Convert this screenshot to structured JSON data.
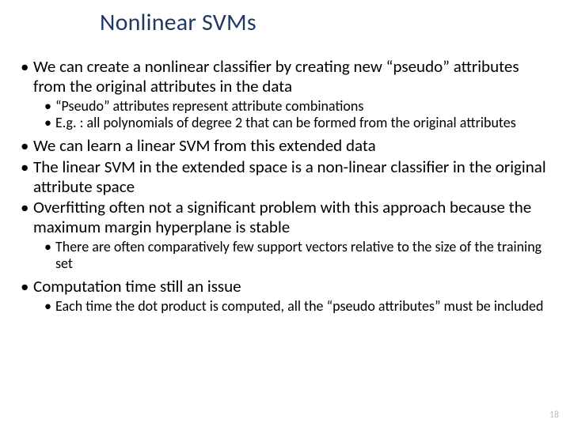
{
  "title": "Nonlinear SVMs",
  "bullets": {
    "b1": "We can create a nonlinear classifier by creating new “pseudo” attributes from the original attributes in the data",
    "b1s": {
      "a": "“Pseudo” attributes represent attribute combinations",
      "b": "E.g. : all polynomials of degree 2 that can be formed from the original attributes"
    },
    "b2": "We can learn a linear SVM from this extended data",
    "b3": "The linear SVM in the extended space is a non-linear classifier in the original attribute space",
    "b4": "Overfitting often not a significant problem with this approach because the maximum margin hyperplane is stable",
    "b4s": {
      "a": "There are often comparatively few support vectors relative to the size of the training set"
    },
    "b5": "Computation time still an issue",
    "b5s": {
      "a": "Each time the dot product is computed, all the “pseudo attributes” must be included"
    }
  },
  "page_number": "18"
}
